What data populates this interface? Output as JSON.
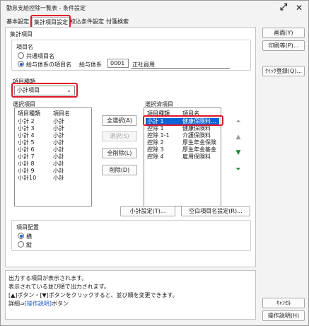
{
  "window": {
    "title": "勤怠支給控除一覧表 - 条件設定",
    "expand_icon": "expand-diagonal-arrows",
    "close_icon": "close-x"
  },
  "tabs": [
    {
      "label": "基本設定",
      "active": false
    },
    {
      "label": "集計項目設定",
      "active": true
    },
    {
      "label": "絞込条件設定",
      "active": false
    },
    {
      "label": "付箋検索",
      "active": false
    }
  ],
  "panel": {
    "section_title": "集計項目",
    "item_name": {
      "group_label": "項目名",
      "radio_common": "共通項目名",
      "radio_system": "給与体系の項目名",
      "system_label": "給与体系",
      "system_code": "0001",
      "system_name": "正社員用"
    },
    "item_type": {
      "label": "項目種類",
      "selected": "小計項目"
    },
    "available": {
      "label": "選択項目",
      "col_type": "項目種類",
      "col_name": "項目名",
      "rows": [
        {
          "type": "小計 2",
          "name": "小計"
        },
        {
          "type": "小計 3",
          "name": "小計"
        },
        {
          "type": "小計 4",
          "name": "小計"
        },
        {
          "type": "小計 5",
          "name": "小計"
        },
        {
          "type": "小計 6",
          "name": "小計"
        },
        {
          "type": "小計 7",
          "name": "小計"
        },
        {
          "type": "小計 8",
          "name": "小計"
        },
        {
          "type": "小計 9",
          "name": "小計"
        },
        {
          "type": "小計10",
          "name": "小計"
        }
      ]
    },
    "middle_buttons": {
      "select_all": "全選択(A)",
      "select": "選択(S)",
      "clear_all": "全削除(L)",
      "delete": "削除(D)"
    },
    "selected_list": {
      "label": "選択済項目",
      "col_type": "項目種類",
      "col_name": "項目名",
      "rows": [
        {
          "type": "小計 1",
          "name": "健康保険料..."
        },
        {
          "type": "控除 1",
          "name": "健康保険料"
        },
        {
          "type": "控除 1-1",
          "name": "介護保険料"
        },
        {
          "type": "控除 2",
          "name": "厚生年金保険"
        },
        {
          "type": "控除 3",
          "name": "厚生年金基金"
        },
        {
          "type": "控除 4",
          "name": "雇用保険料"
        }
      ]
    },
    "move_icons": [
      "move-top-icon",
      "move-up-icon",
      "move-down-icon",
      "move-bottom-icon"
    ],
    "subtotal_button": "小計設定(T)...",
    "blank_button": "空白項目名設定(R)...",
    "placement": {
      "label": "項目配置",
      "horizontal": "横",
      "vertical": "縦",
      "selected": "横"
    }
  },
  "right_buttons": {
    "screen": "画面(Y)",
    "print": "印刷等(P)...",
    "register": "ｸｲｯｸ登録(Q)...",
    "cancel": "ｷｬﾝｾﾙ",
    "help": "操作説明(H)"
  },
  "info": {
    "line1": "出力する項目が表示されます。",
    "line2": "表示されている並び順で出力されます。",
    "line3": "[▲]ボタン・[▼]ボタンをクリックすると、並び順を変更できます。",
    "line4_prefix": "詳細⇒",
    "line4_link": "[操作説明]",
    "line4_suffix": "ボタン"
  },
  "colors": {
    "highlight_red": "#e0162b",
    "selection_blue": "#0a64d8",
    "arrow_green": "#1a8a2e",
    "link_blue": "#1a56c9"
  }
}
